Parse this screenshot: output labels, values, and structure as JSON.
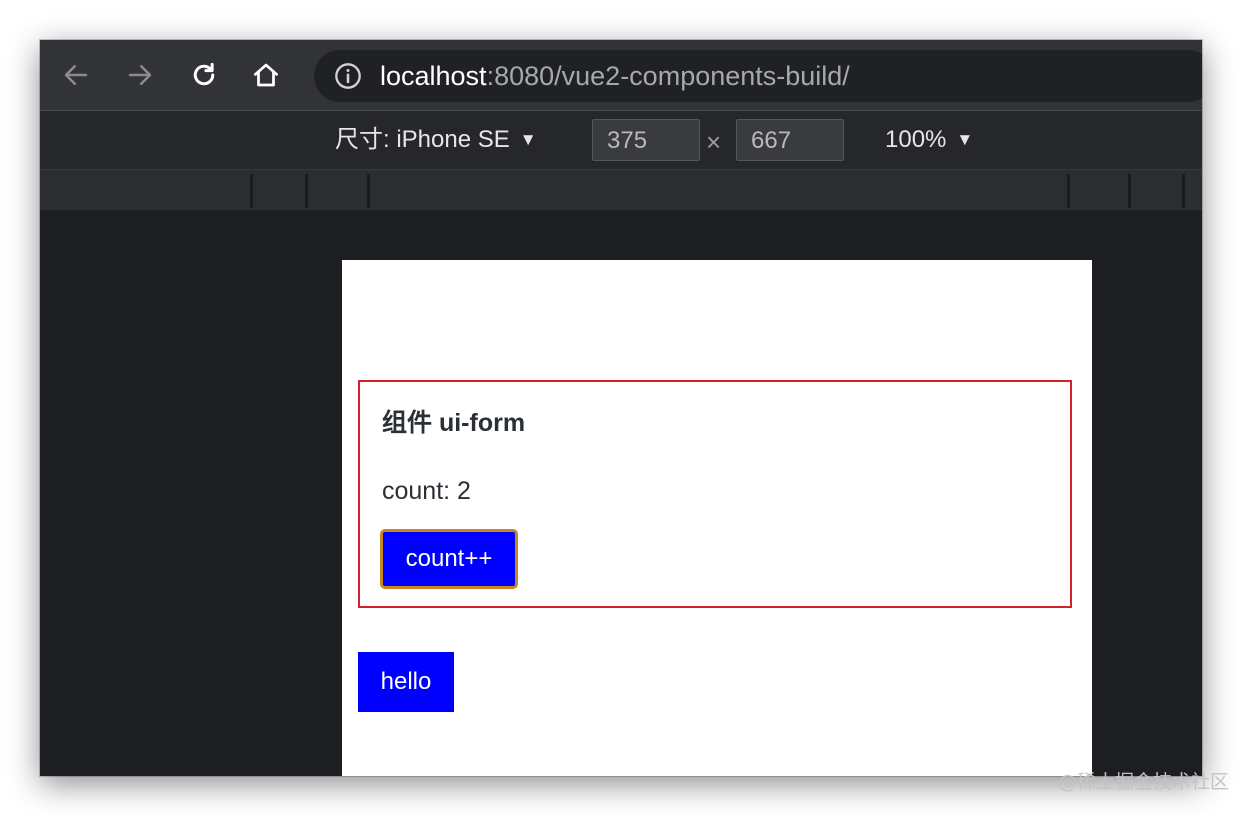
{
  "browser": {
    "url_host": "localhost",
    "url_rest": ":8080/vue2-components-build/"
  },
  "device_toolbar": {
    "device_label": "尺寸: iPhone SE",
    "width_value": "375",
    "height_value": "667",
    "times_symbol": "×",
    "zoom_label": "100%",
    "caret": "▼"
  },
  "page": {
    "component_title": "组件 ui-form",
    "count_text": "count: 2",
    "count_button_label": "count++",
    "hello_button_label": "hello"
  },
  "colors": {
    "component_border": "#d6212a",
    "button_blue": "#0000ff",
    "focus_ring": "#c88720"
  },
  "watermark": "@稀土掘金技术社区"
}
